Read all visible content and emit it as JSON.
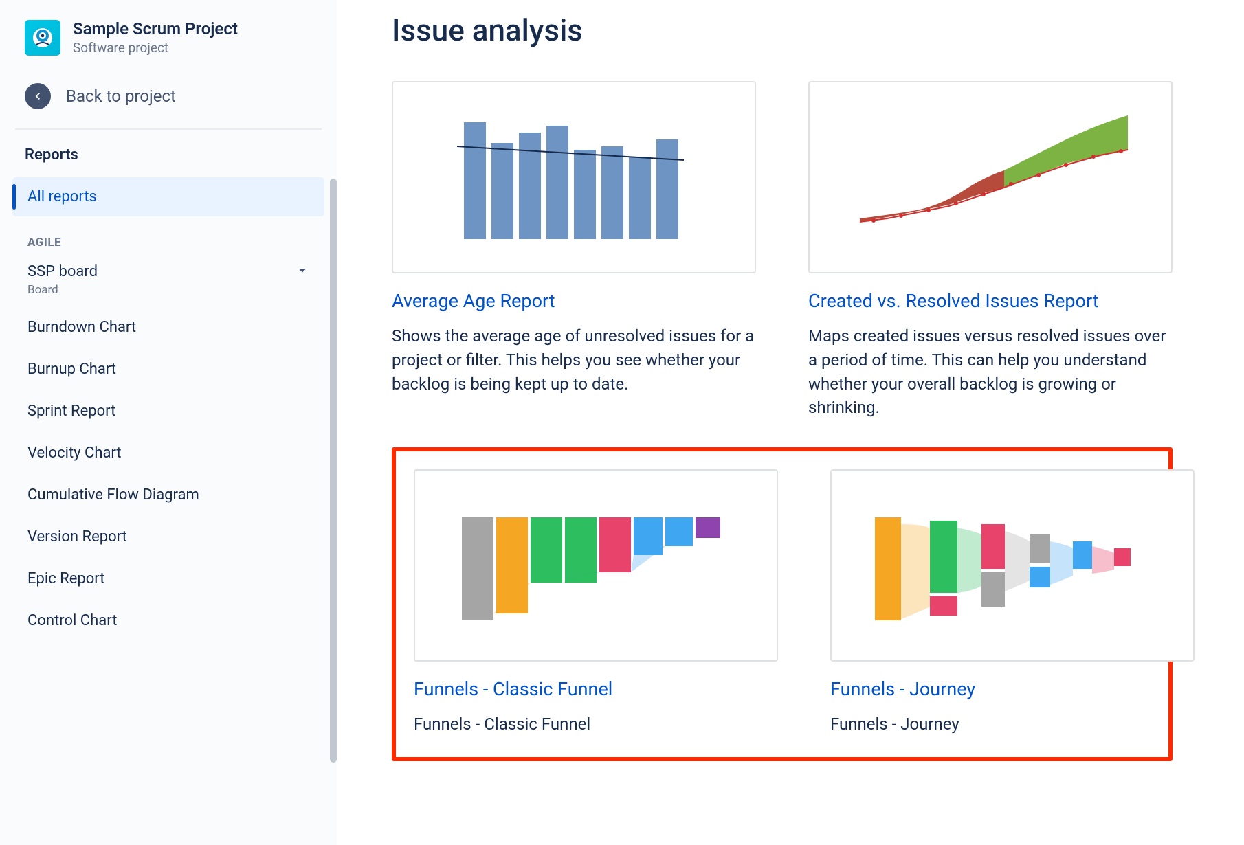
{
  "sidebar": {
    "project_title": "Sample Scrum Project",
    "project_subtitle": "Software project",
    "back_label": "Back to project",
    "section_heading": "Reports",
    "all_reports_label": "All reports",
    "group_label": "AGILE",
    "board": {
      "name": "SSP board",
      "subtitle": "Board"
    },
    "reports": [
      "Burndown Chart",
      "Burnup Chart",
      "Sprint Report",
      "Velocity Chart",
      "Cumulative Flow Diagram",
      "Version Report",
      "Epic Report",
      "Control Chart"
    ]
  },
  "main": {
    "heading": "Issue analysis",
    "cards": [
      {
        "title": "Average Age Report",
        "desc": "Shows the average age of unresolved issues for a project or filter. This helps you see whether your backlog is being kept up to date."
      },
      {
        "title": "Created vs. Resolved Issues Report",
        "desc": "Maps created issues versus resolved issues over a period of time. This can help you understand whether your overall backlog is growing or shrinking."
      },
      {
        "title": "Funnels - Classic Funnel",
        "desc": "Funnels - Classic Funnel"
      },
      {
        "title": "Funnels - Journey",
        "desc": "Funnels - Journey"
      }
    ]
  }
}
